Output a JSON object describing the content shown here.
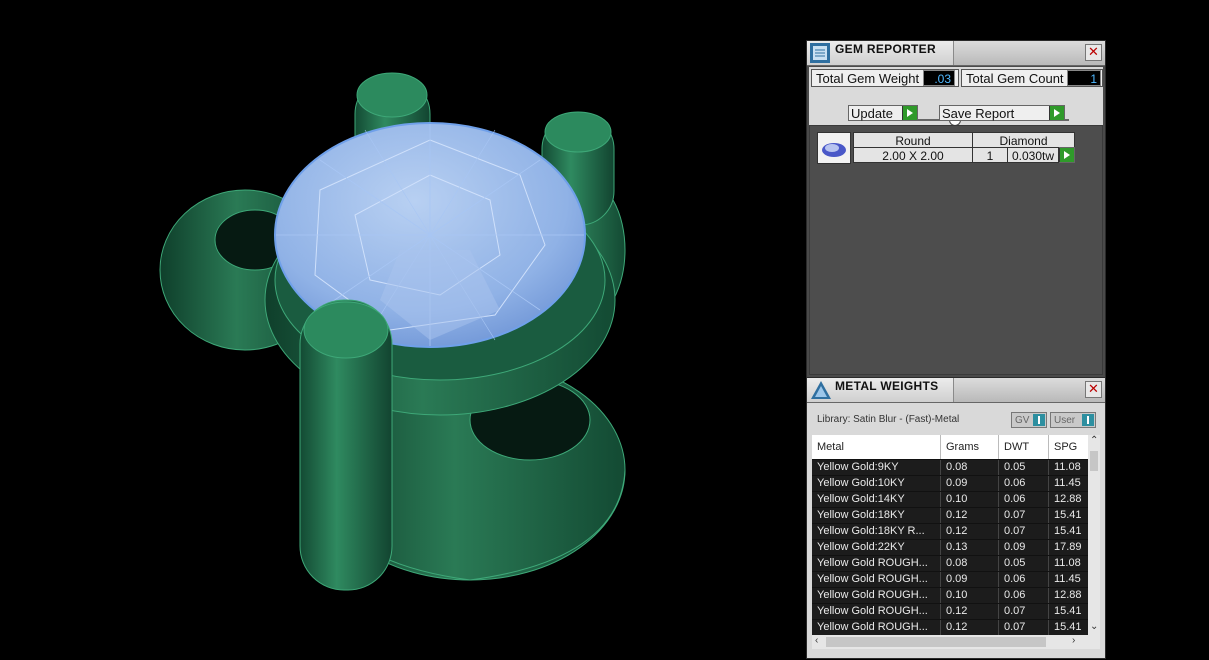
{
  "gem_reporter": {
    "title": "GEM REPORTER",
    "close_glyph": "✕",
    "total_weight_label": "Total Gem Weight",
    "total_weight_value": ".03",
    "total_count_label": "Total Gem Count",
    "total_count_value": "1",
    "update_label": "Update",
    "save_report_label": "Save Report",
    "gem_row": {
      "cut": "Round",
      "material": "Diamond",
      "size": "2.00 X 2.00",
      "qty": "1",
      "weight": "0.030tw"
    }
  },
  "metal_weights": {
    "title": "METAL WEIGHTS",
    "close_glyph": "✕",
    "library_text": "Library: Satin Blur - (Fast)-Metal",
    "gv_label": "GV",
    "user_label": "User",
    "columns": [
      "Metal",
      "Grams",
      "DWT",
      "SPG"
    ],
    "rows": [
      [
        "Yellow Gold:9KY",
        "0.08",
        "0.05",
        "11.08"
      ],
      [
        "Yellow Gold:10KY",
        "0.09",
        "0.06",
        "11.45"
      ],
      [
        "Yellow Gold:14KY",
        "0.10",
        "0.06",
        "12.88"
      ],
      [
        "Yellow Gold:18KY",
        "0.12",
        "0.07",
        "15.41"
      ],
      [
        "Yellow Gold:18KY R...",
        "0.12",
        "0.07",
        "15.41"
      ],
      [
        "Yellow Gold:22KY",
        "0.13",
        "0.09",
        "17.89"
      ],
      [
        "Yellow Gold ROUGH...",
        "0.08",
        "0.05",
        "11.08"
      ],
      [
        "Yellow Gold ROUGH...",
        "0.09",
        "0.06",
        "11.45"
      ],
      [
        "Yellow Gold ROUGH...",
        "0.10",
        "0.06",
        "12.88"
      ],
      [
        "Yellow Gold ROUGH...",
        "0.12",
        "0.07",
        "15.41"
      ],
      [
        "Yellow Gold ROUGH...",
        "0.12",
        "0.07",
        "15.41"
      ]
    ]
  },
  "colors": {
    "metal_green": "#1f6b4a",
    "gem_blue": "#8fb8f0",
    "accent_green": "#2f9a2a",
    "value_blue": "#4fb8ff"
  }
}
